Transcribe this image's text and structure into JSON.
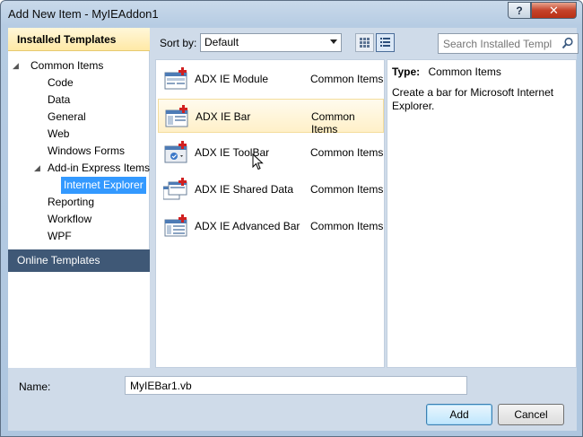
{
  "window": {
    "title": "Add New Item - MyIEAddon1",
    "help_label": "?",
    "close_label": "✕"
  },
  "left": {
    "installed_header": "Installed Templates",
    "tree": [
      {
        "label": "Common Items",
        "expanded": true
      },
      {
        "label": "Code"
      },
      {
        "label": "Data"
      },
      {
        "label": "General"
      },
      {
        "label": "Web"
      },
      {
        "label": "Windows Forms"
      },
      {
        "label": "Add-in Express Items",
        "expanded": true
      },
      {
        "label": "Internet Explorer",
        "selected": true
      },
      {
        "label": "Reporting"
      },
      {
        "label": "Workflow"
      },
      {
        "label": "WPF"
      }
    ],
    "online_header": "Online Templates"
  },
  "toolbar": {
    "sort_label": "Sort by:",
    "sort_value": "Default",
    "search_placeholder": "Search Installed Templ"
  },
  "items": [
    {
      "name": "ADX IE Module",
      "category": "Common Items",
      "icon": "adx-module-icon"
    },
    {
      "name": "ADX IE Bar",
      "category": "Common Items",
      "icon": "adx-bar-icon",
      "hover": true
    },
    {
      "name": "ADX IE ToolBar",
      "category": "Common Items",
      "icon": "adx-toolbar-icon"
    },
    {
      "name": "ADX IE Shared Data",
      "category": "Common Items",
      "icon": "adx-shared-data-icon"
    },
    {
      "name": "ADX IE Advanced Bar",
      "category": "Common Items",
      "icon": "adx-advanced-bar-icon"
    }
  ],
  "info": {
    "type_label": "Type:",
    "type_value": "Common Items",
    "description": "Create a bar for Microsoft Internet Explorer."
  },
  "name_row": {
    "label": "Name:",
    "value": "MyIEBar1.vb"
  },
  "buttons": {
    "add": "Add",
    "cancel": "Cancel"
  },
  "colors": {
    "selection": "#3399ff",
    "online_header": "#3f5876",
    "hover_row": "#fff0c8"
  }
}
